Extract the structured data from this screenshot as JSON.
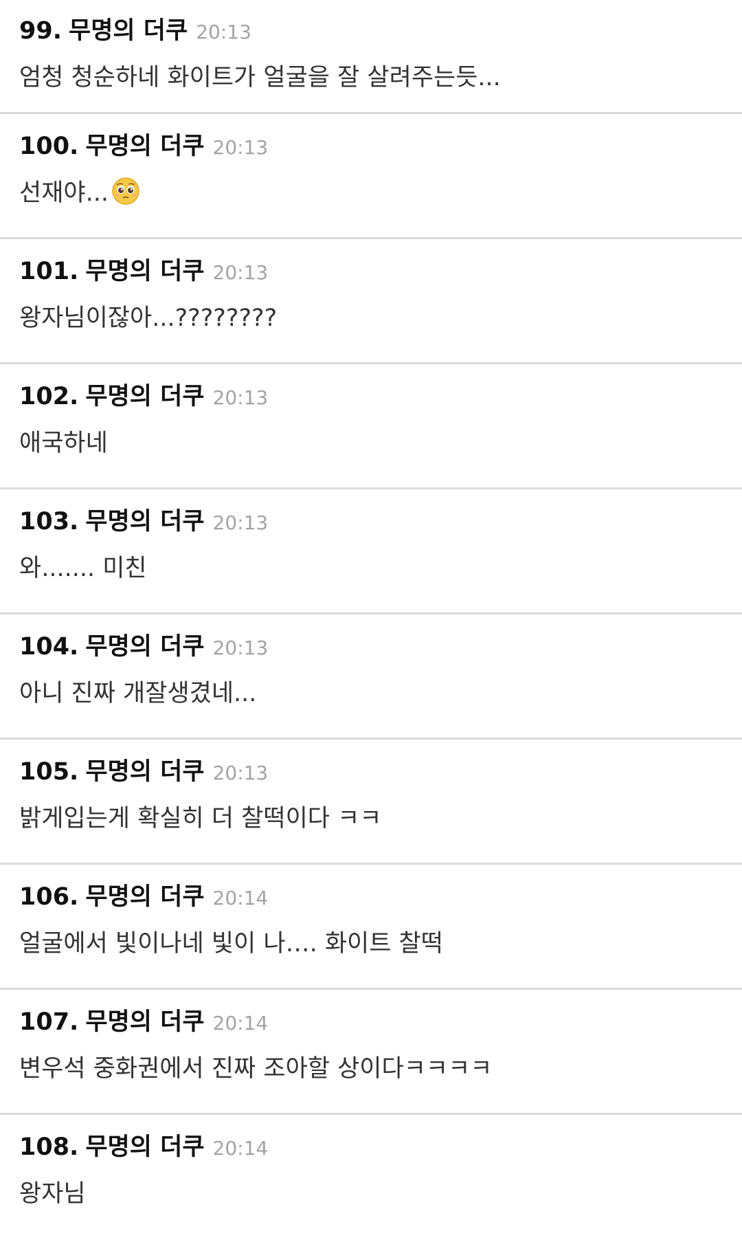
{
  "comments": [
    {
      "number": "99.",
      "author": "무명의 더쿠",
      "time": "20:13",
      "text": "엄청 청순하네 화이트가 얼굴을 잘 살려주는듯..."
    },
    {
      "number": "100.",
      "author": "무명의 더쿠",
      "time": "20:13",
      "text": "선재야...",
      "emoji": "pleading-face-icon"
    },
    {
      "number": "101.",
      "author": "무명의 더쿠",
      "time": "20:13",
      "text": "왕자님이잖아...????????"
    },
    {
      "number": "102.",
      "author": "무명의 더쿠",
      "time": "20:13",
      "text": "애국하네"
    },
    {
      "number": "103.",
      "author": "무명의 더쿠",
      "time": "20:13",
      "text": "와....... 미친"
    },
    {
      "number": "104.",
      "author": "무명의 더쿠",
      "time": "20:13",
      "text": "아니 진짜 개잘생겼네..."
    },
    {
      "number": "105.",
      "author": "무명의 더쿠",
      "time": "20:13",
      "text": "밝게입는게 확실히 더 찰떡이다 ㅋㅋ"
    },
    {
      "number": "106.",
      "author": "무명의 더쿠",
      "time": "20:14",
      "text": "얼굴에서 빛이나네 빛이 나…. 화이트 찰떡"
    },
    {
      "number": "107.",
      "author": "무명의 더쿠",
      "time": "20:14",
      "text": "변우석 중화권에서 진짜 조아할 상이다ㅋㅋㅋㅋ"
    },
    {
      "number": "108.",
      "author": "무명의 더쿠",
      "time": "20:14",
      "text": "왕자님"
    }
  ],
  "colors": {
    "divider": "#d9d9d9",
    "time": "#a3a3a3",
    "text": "#333333",
    "header": "#111111"
  }
}
